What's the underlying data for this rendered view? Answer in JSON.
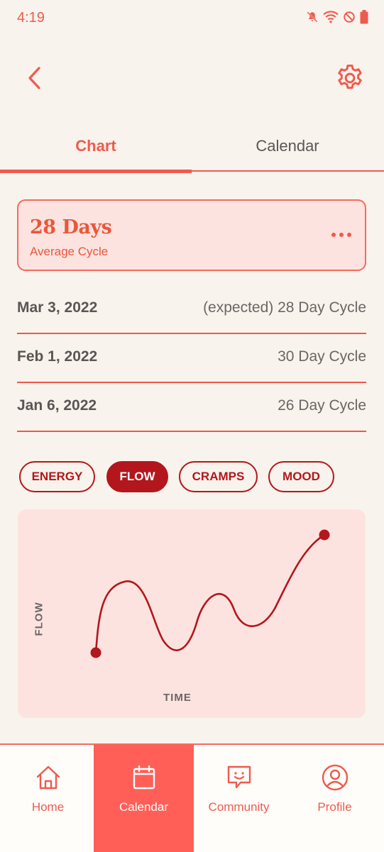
{
  "status_bar": {
    "time": "4:19",
    "icons": [
      "mute-icon",
      "wifi-icon",
      "do-not-disturb-icon",
      "battery-icon"
    ]
  },
  "top_bar": {
    "back_icon": "chevron-left-icon",
    "settings_icon": "gear-icon"
  },
  "tabs": [
    {
      "label": "Chart",
      "active": true
    },
    {
      "label": "Calendar",
      "active": false
    }
  ],
  "average_card": {
    "days": "28 Days",
    "label": "Average Cycle",
    "menu_icon": "more-horizontal-icon"
  },
  "cycles": [
    {
      "date": "Mar 3, 2022",
      "length": "(expected) 28 Day Cycle"
    },
    {
      "date": "Feb 1, 2022",
      "length": "30 Day Cycle"
    },
    {
      "date": "Jan 6, 2022",
      "length": "26 Day Cycle"
    }
  ],
  "filters": [
    {
      "label": "ENERGY",
      "selected": false
    },
    {
      "label": "FLOW",
      "selected": true
    },
    {
      "label": "CRAMPS",
      "selected": false
    },
    {
      "label": "MOOD",
      "selected": false
    }
  ],
  "chart": {
    "ylabel": "FLOW",
    "xlabel": "TIME"
  },
  "bottom_nav": [
    {
      "label": "Home",
      "icon": "home-icon",
      "active": false
    },
    {
      "label": "Calendar",
      "icon": "calendar-icon",
      "active": true
    },
    {
      "label": "Community",
      "icon": "chat-smile-icon",
      "active": false
    },
    {
      "label": "Profile",
      "icon": "user-circle-icon",
      "active": false
    }
  ],
  "colors": {
    "background": "#f8f3ec",
    "accent": "#ef5a4f",
    "dark_red": "#b3161c",
    "card_fill": "#fde3df",
    "active_nav": "#ff5f57"
  }
}
